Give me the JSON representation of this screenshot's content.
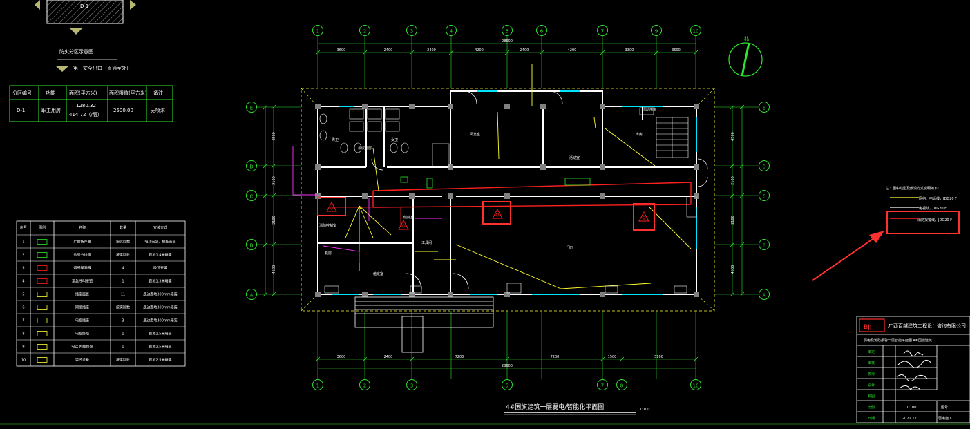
{
  "drawing": {
    "title": "4#国旗建筑一层弱电/智能化平面图",
    "scale": "1:100",
    "north_label": "北"
  },
  "key_plan": {
    "zone_label": "D-1",
    "heading": "防火分区示意图",
    "exit_note": "第一安全出口（直通室外）"
  },
  "zone_table": {
    "headers": [
      "分区编号",
      "功能",
      "面积(平方米)",
      "面积限值(平方米)",
      "备注"
    ],
    "row": [
      "D-1",
      "职工用房",
      "1280.32",
      "2500.00",
      "无喷淋"
    ],
    "row_sub": "414.72（/层）"
  },
  "axes": {
    "numbers": [
      "1",
      "2",
      "3",
      "4",
      "5",
      "6",
      "7",
      "8",
      "9",
      "10"
    ],
    "bottom_numbers": [
      "1",
      "2",
      "3",
      "5",
      "7",
      "8",
      "10"
    ],
    "letters": [
      "E",
      "D",
      "C",
      "B",
      "A"
    ]
  },
  "dims": {
    "top": [
      "3600",
      "2400",
      "2400",
      "4200",
      "2400",
      "4200",
      "3300",
      "3600"
    ],
    "top_total": "28600",
    "bottom": [
      "3600",
      "2400",
      "7200",
      "7200",
      "1500",
      "5100"
    ],
    "bottom_total": "28600",
    "right_left": [
      "4500",
      "2100",
      "2100",
      "4500"
    ]
  },
  "rooms": [
    "男卫",
    "女卫",
    "消防控制室",
    "机房",
    "值班室",
    "阅览室",
    "活动室",
    "库房",
    "工具间",
    "门厅",
    "会议用房",
    "活动用房",
    "储藏室"
  ],
  "legend_table": {
    "headers": [
      "序号",
      "图例",
      "名称",
      "数量",
      "安装方式"
    ],
    "rows": [
      [
        "1",
        "▭",
        "广播扬声器",
        "按实际数",
        "吸顶安装，壁挂安装"
      ],
      [
        "2",
        "▢",
        "信号分线箱",
        "按实际数",
        "距地1.4米暗装"
      ],
      [
        "3",
        "△",
        "烟感探测器",
        "4",
        "吸顶安装"
      ],
      [
        "4",
        "○",
        "紧急呼叫按钮",
        "1",
        "距地1.3米暗装"
      ],
      [
        "5",
        "▭",
        "插座面板",
        "11",
        "底边距地300mm暗装"
      ],
      [
        "6",
        "▭",
        "网络插座",
        "按实际数",
        "底边距地300mm暗装"
      ],
      [
        "7",
        "▭",
        "电视插座",
        "3",
        "底边距地300mm暗装"
      ],
      [
        "8",
        "▭",
        "电视终端",
        "1",
        "距地1.5米暗装"
      ],
      [
        "9",
        "▭",
        "电话 网络终端",
        "1",
        "距地1.5米暗装"
      ],
      [
        "10",
        "▭",
        "监控设备",
        "按实际数",
        "距地2.5米暗装"
      ]
    ]
  },
  "wire_legend": {
    "heading": "注：图中线型及敷设方式说明如下：",
    "lines": [
      "网络、电话线，JDG20 F",
      "电视线，JDG20 F",
      "消防报警线，JDG20 F"
    ],
    "colors": [
      "#ffff30",
      "#ffffff",
      "#ff2020"
    ]
  },
  "title_block": {
    "company": "广西百越建筑工程设计咨询有限公司",
    "logo": "BJJ",
    "project_line": "弱电及消防报警一层智能平面图    4#国旗建筑",
    "roles": [
      "审定",
      "审核",
      "校对",
      "设计",
      "制图",
      "比例",
      "日期"
    ],
    "scale": "1:100",
    "date": "2021.12",
    "sheet_label": "图号",
    "sheet_value": "弱电施工"
  },
  "colors": {
    "background": "#000000",
    "axis": "#2ee52e",
    "wall": "#ffffff",
    "fire": "#ff2020",
    "signal": "#ffff30",
    "highlight": "#ff3030",
    "aux": "#ff30ff",
    "window": "#00e5ff"
  }
}
